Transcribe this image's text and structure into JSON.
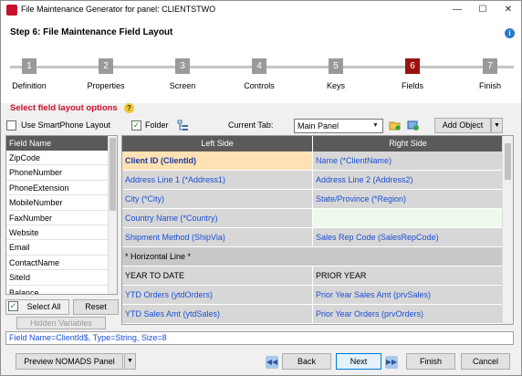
{
  "title": "File Maintenance Generator for panel: CLIENTSTWO",
  "step_title": "Step 6: File Maintenance Field Layout",
  "steps": [
    {
      "num": "1",
      "label": "Definition"
    },
    {
      "num": "2",
      "label": "Properties"
    },
    {
      "num": "3",
      "label": "Screen"
    },
    {
      "num": "4",
      "label": "Controls"
    },
    {
      "num": "5",
      "label": "Keys"
    },
    {
      "num": "6",
      "label": "Fields"
    },
    {
      "num": "7",
      "label": "Finish"
    }
  ],
  "active_step": 6,
  "section_label": "Select field layout options",
  "smartphone_label": "Use SmartPhone Layout",
  "smartphone_checked": false,
  "folder_label": "Folder",
  "folder_checked": true,
  "current_tab_label": "Current Tab:",
  "current_tab_value": "Main Panel",
  "add_object_label": "Add Object",
  "field_list": {
    "header": "Field Name",
    "items": [
      "ZipCode",
      "PhoneNumber",
      "PhoneExtension",
      "MobileNumber",
      "FaxNumber",
      "Website",
      "Email",
      "ContactName",
      "SiteId",
      "Balance"
    ]
  },
  "select_all_label": "Select All",
  "reset_label": "Reset",
  "hidden_vars_label": "Hidden Variables",
  "layout": {
    "left_header": "Left Side",
    "right_header": "Right Side",
    "rows": [
      {
        "left": "Client ID (ClientId)",
        "right": "Name (*ClientName)"
      },
      {
        "left": "Address Line 1 (*Address1)",
        "right": "Address Line 2 (Address2)"
      },
      {
        "left": "City (*City)",
        "right": "State/Province (*Region)"
      },
      {
        "left": "Country Name (*Country)",
        "right": ""
      },
      {
        "left": "Shipment Method (ShipVia)",
        "right": "Sales Rep Code (SalesRepCode)"
      },
      {
        "left": "* Horizontal Line *",
        "right": ""
      },
      {
        "left": "YEAR TO DATE",
        "right": "PRIOR YEAR"
      },
      {
        "left": "YTD Orders (ytdOrders)",
        "right": "Prior Year Sales Amt (prvSales)"
      },
      {
        "left": "YTD Sales Amt (ytdSales)",
        "right": "Prior Year Orders (prvOrders)"
      }
    ]
  },
  "status_text": "Field Name=ClientId$,  Type=String,  Size=8",
  "preview_label": "Preview NOMADS Panel",
  "back_label": "Back",
  "next_label": "Next",
  "finish_label": "Finish",
  "cancel_label": "Cancel",
  "colors": {
    "accent_red": "#c8102e",
    "active_step": "#9b1111",
    "link_blue": "#1a4fd6",
    "selected_cell": "#ffe2b3",
    "empty_cell": "#eefaee"
  }
}
